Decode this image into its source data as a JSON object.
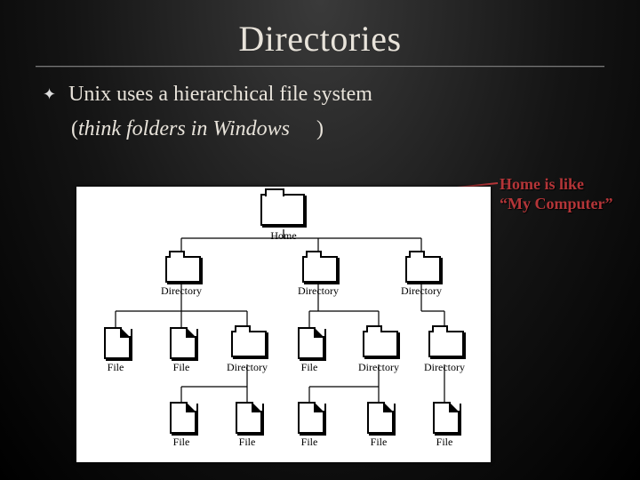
{
  "title": "Directories",
  "bullet": "Unix uses a hierarchical file system",
  "folders_hint_open": "(",
  "folders_hint_italic": "think folders in Windows",
  "folders_hint_close": ")",
  "annotation_line1": "Home is like",
  "annotation_line2": "“My Computer”",
  "nodes": {
    "home": "Home",
    "dirA": "Directory",
    "dirB": "Directory",
    "dirC": "Directory",
    "r2_0": "File",
    "r2_1": "File",
    "r2_2": "Directory",
    "r2_3": "File",
    "r2_4": "Directory",
    "r2_5": "Directory",
    "r3_0": "File",
    "r3_1": "File",
    "r3_2": "File",
    "r3_3": "File",
    "r3_4": "File"
  }
}
